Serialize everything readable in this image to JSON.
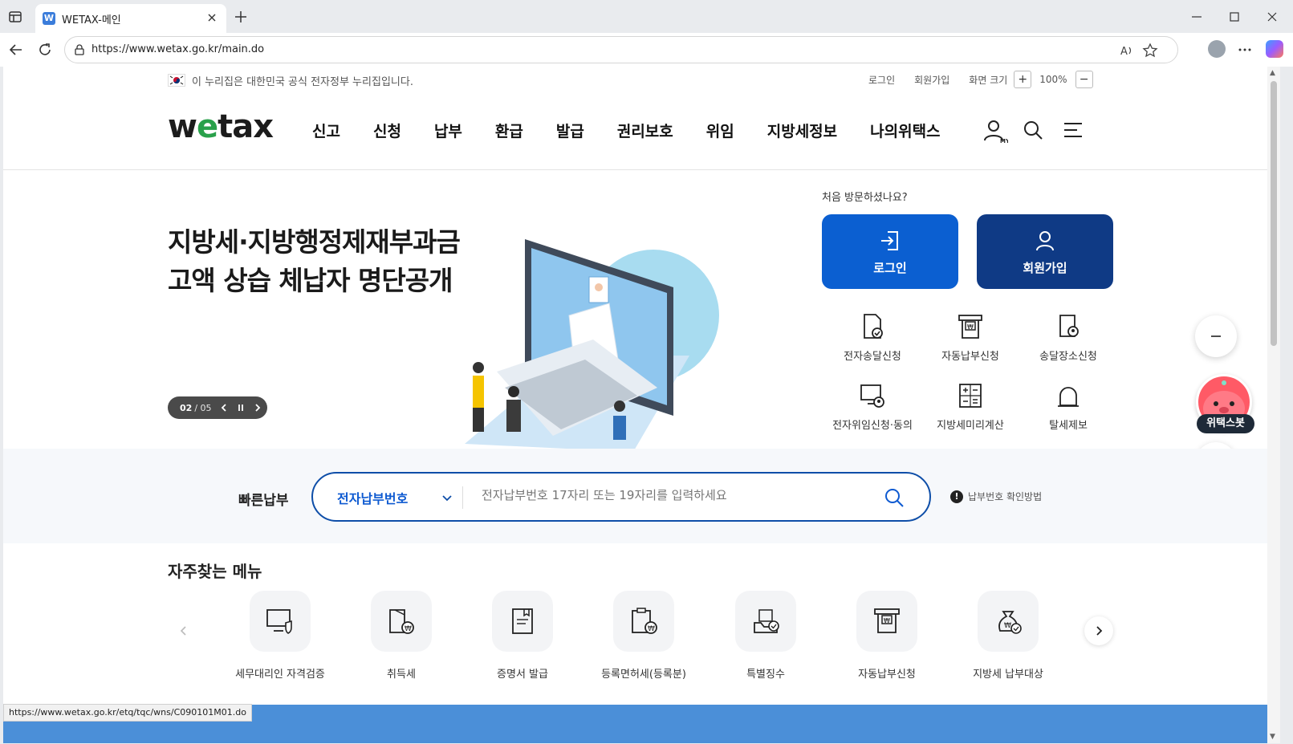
{
  "browser": {
    "tab_title": "WETAX-메인",
    "favicon_letter": "W",
    "url": "https://www.wetax.go.kr/main.do"
  },
  "header": {
    "gov_banner": "이 누리집은 대한민국 공식 전자정부 누리집입니다.",
    "utility": {
      "login": "로그인",
      "signup": "회원가입",
      "screen_size": "화면 크기",
      "zoom_in": "+",
      "zoom_level": "100%",
      "zoom_out": "−"
    },
    "logo": {
      "w": "w",
      "e": "e",
      "tax": "tax"
    },
    "nav": [
      "신고",
      "신청",
      "납부",
      "환급",
      "발급",
      "권리보호",
      "위임",
      "지방세정보",
      "나의위택스"
    ],
    "my_label": "MY"
  },
  "hero": {
    "title_line1": "지방세·지방행정제재부과금",
    "title_line2": "고액 상습 체납자 명단공개",
    "slide_current": "02",
    "slide_total": "/ 05"
  },
  "side": {
    "first_visit": "처음 방문하셨나요?",
    "login_button": "로그인",
    "signup_button": "회원가입",
    "services": [
      {
        "label": "전자송달신청",
        "icon": "document-check-icon"
      },
      {
        "label": "자동납부신청",
        "icon": "auto-pay-icon"
      },
      {
        "label": "송달장소신청",
        "icon": "location-doc-icon"
      },
      {
        "label": "전자위임신청·동의",
        "icon": "monitor-delegate-icon"
      },
      {
        "label": "지방세미리계산",
        "icon": "calculator-icon"
      },
      {
        "label": "탈세제보",
        "icon": "alarm-bell-icon"
      }
    ]
  },
  "floating": {
    "bot_label": "위택스봇"
  },
  "quick_pay": {
    "label": "빠른납부",
    "select_value": "전자납부번호",
    "placeholder": "전자납부번호 17자리 또는 19자리를 입력하세요",
    "help": "납부번호 확인방법"
  },
  "favorites": {
    "title": "자주찾는 메뉴",
    "items": [
      {
        "label": "세무대리인 자격검증",
        "icon": "monitor-shield-icon"
      },
      {
        "label": "취득세",
        "icon": "building-tax-icon"
      },
      {
        "label": "증명서 발급",
        "icon": "certificate-icon"
      },
      {
        "label": "등록면허세(등록분)",
        "icon": "registration-tax-icon"
      },
      {
        "label": "특별징수",
        "icon": "special-collection-icon"
      },
      {
        "label": "자동납부신청",
        "icon": "auto-pay-icon"
      },
      {
        "label": "지방세 납부대상",
        "icon": "money-bag-icon"
      }
    ]
  },
  "status_bar_url": "https://www.wetax.go.kr/etq/tqc/wns/C090101M01.do",
  "colors": {
    "primary_blue": "#0b5fd1",
    "navy": "#0f3a85",
    "logo_green": "#2aa14b",
    "quickpay_border": "#0e4ea8"
  }
}
